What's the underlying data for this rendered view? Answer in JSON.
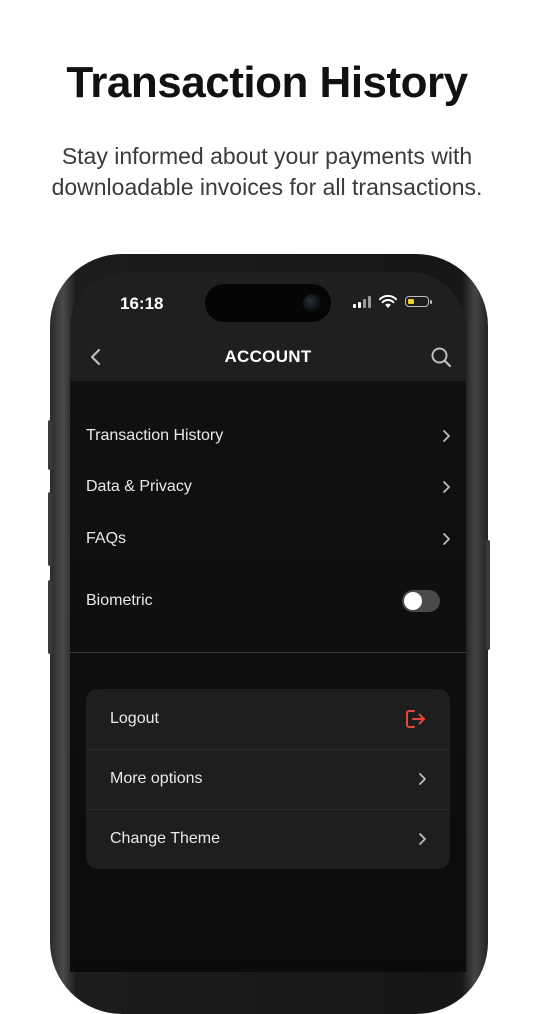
{
  "promo": {
    "headline": "Transaction History",
    "subhead": "Stay informed about your payments with downloadable invoices for all transactions."
  },
  "status_bar": {
    "time": "16:18",
    "icons": [
      "cellular-signal-icon",
      "wifi-icon",
      "battery-icon"
    ],
    "battery_color": "#f2d21b"
  },
  "app_bar": {
    "title": "ACCOUNT",
    "left_icon": "back-chevron-icon",
    "right_icon": "search-icon"
  },
  "menu": {
    "items": [
      {
        "label": "Transaction History",
        "icon": "chevron-right-icon"
      },
      {
        "label": "Data & Privacy",
        "icon": "chevron-right-icon"
      },
      {
        "label": "FAQs",
        "icon": "chevron-right-icon"
      }
    ],
    "biometric": {
      "label": "Biometric",
      "enabled": false
    }
  },
  "actions": {
    "items": [
      {
        "label": "Logout",
        "icon": "logout-icon",
        "icon_color": "#e0483b"
      },
      {
        "label": "More options",
        "icon": "chevron-right-icon"
      },
      {
        "label": "Change Theme",
        "icon": "chevron-right-icon"
      }
    ]
  },
  "colors": {
    "background": "#ffffff",
    "screen_background": "#0c0c0c",
    "card_background": "#1e1e1e",
    "accent_danger": "#e0483b"
  }
}
